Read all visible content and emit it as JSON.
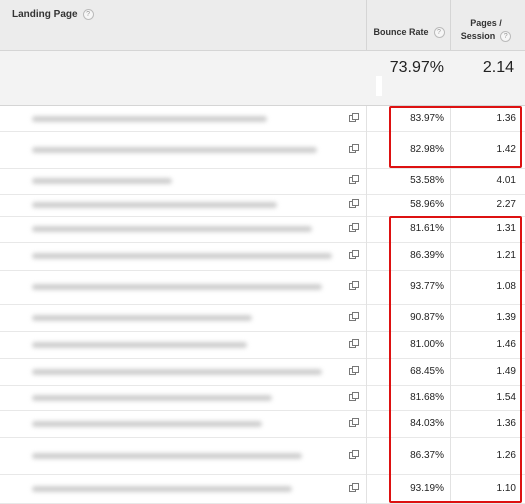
{
  "header": {
    "landing_page_label": "Landing Page",
    "help_glyph": "?",
    "bounce_rate_label": "Bounce Rate",
    "pages_session_label_1": "Pages /",
    "pages_session_label_2": "Session"
  },
  "totals": {
    "bounce_rate": "73.97%",
    "pages_per_session": "2.14"
  },
  "rows": [
    {
      "bounce_rate": "83.97%",
      "pages_per_session": "1.36"
    },
    {
      "bounce_rate": "82.98%",
      "pages_per_session": "1.42"
    },
    {
      "bounce_rate": "53.58%",
      "pages_per_session": "4.01"
    },
    {
      "bounce_rate": "58.96%",
      "pages_per_session": "2.27"
    },
    {
      "bounce_rate": "81.61%",
      "pages_per_session": "1.31"
    },
    {
      "bounce_rate": "86.39%",
      "pages_per_session": "1.21"
    },
    {
      "bounce_rate": "93.77%",
      "pages_per_session": "1.08"
    },
    {
      "bounce_rate": "90.87%",
      "pages_per_session": "1.39"
    },
    {
      "bounce_rate": "81.00%",
      "pages_per_session": "1.46"
    },
    {
      "bounce_rate": "68.45%",
      "pages_per_session": "1.49"
    },
    {
      "bounce_rate": "81.68%",
      "pages_per_session": "1.54"
    },
    {
      "bounce_rate": "84.03%",
      "pages_per_session": "1.36"
    },
    {
      "bounce_rate": "86.37%",
      "pages_per_session": "1.26"
    },
    {
      "bounce_rate": "93.19%",
      "pages_per_session": "1.10"
    }
  ],
  "highlight_color": "#dd1111",
  "icons": {
    "help": "help-circle-icon",
    "external": "external-link-icon"
  }
}
